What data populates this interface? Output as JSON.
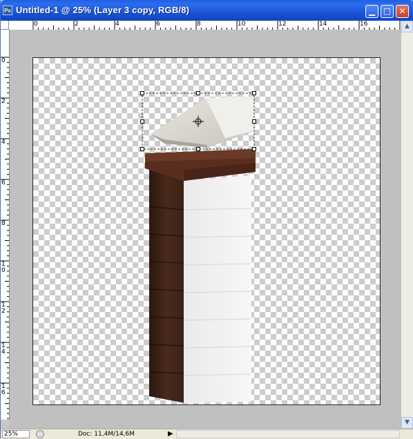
{
  "window": {
    "app_icon": "Ps",
    "title": "Untitled-1 @ 25% (Layer 3 copy, RGB/8)",
    "buttons": {
      "minimize_icon": "minimize-icon",
      "maximize_icon": "maximize-icon",
      "close_icon": "close-icon"
    }
  },
  "ruler": {
    "top_labels": [
      "0",
      "2",
      "4",
      "6",
      "8",
      "10",
      "12",
      "14",
      "16"
    ],
    "left_labels": [
      "0",
      "2",
      "4",
      "6",
      "8",
      "1 0",
      "1 2",
      "1 4",
      "1 6"
    ]
  },
  "document": {
    "layer": "Layer 3 copy",
    "selection": "transform bounding box"
  },
  "status": {
    "zoom": "25%",
    "doc_info": "Doc: 11,4M/14,6M",
    "arrow": "▶"
  }
}
